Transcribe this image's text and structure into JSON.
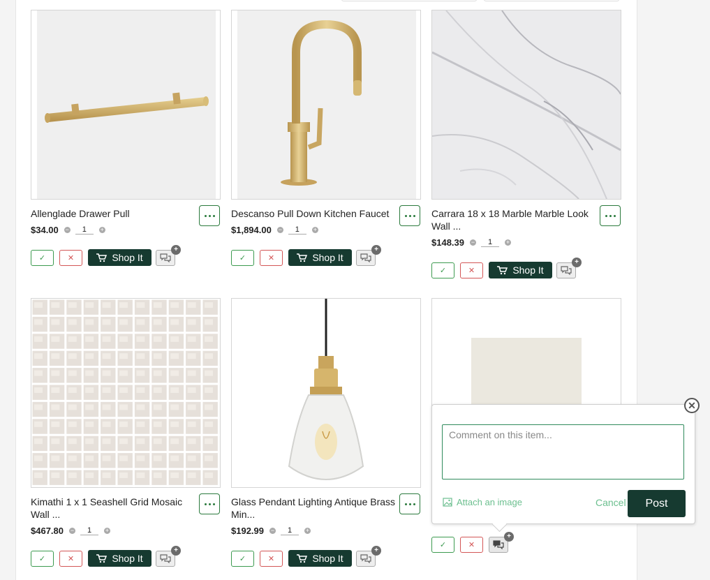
{
  "products": [
    {
      "name": "Allenglade Drawer Pull",
      "price": "$34.00",
      "qty": "1",
      "shop_label": "Shop It"
    },
    {
      "name": "Descanso Pull Down Kitchen Faucet",
      "price": "$1,894.00",
      "qty": "1",
      "shop_label": "Shop It"
    },
    {
      "name": "Carrara 18 x 18 Marble Marble Look Wall ...",
      "price": "$148.39",
      "qty": "1",
      "shop_label": "Shop It"
    },
    {
      "name": "Kimathi 1 x 1 Seashell Grid Mosaic Wall ...",
      "price": "$467.80",
      "qty": "1",
      "shop_label": "Shop It"
    },
    {
      "name": "Glass Pendant Lighting Antique Brass Min...",
      "price": "$192.99",
      "qty": "1",
      "shop_label": "Shop It"
    }
  ],
  "comment_popover": {
    "placeholder": "Comment on this item...",
    "attach_label": "Attach an image",
    "cancel_label": "Cancel",
    "post_label": "Post"
  },
  "icons": {
    "approve": "check-icon",
    "reject": "x-icon",
    "cart": "cart-icon",
    "comment": "comment-icon",
    "more": "more-icon",
    "close": "close-icon",
    "image": "image-icon"
  },
  "colors": {
    "primary": "#163a30",
    "approve": "#3c9a4f",
    "reject": "#d35656",
    "link": "#6cbf8f"
  }
}
